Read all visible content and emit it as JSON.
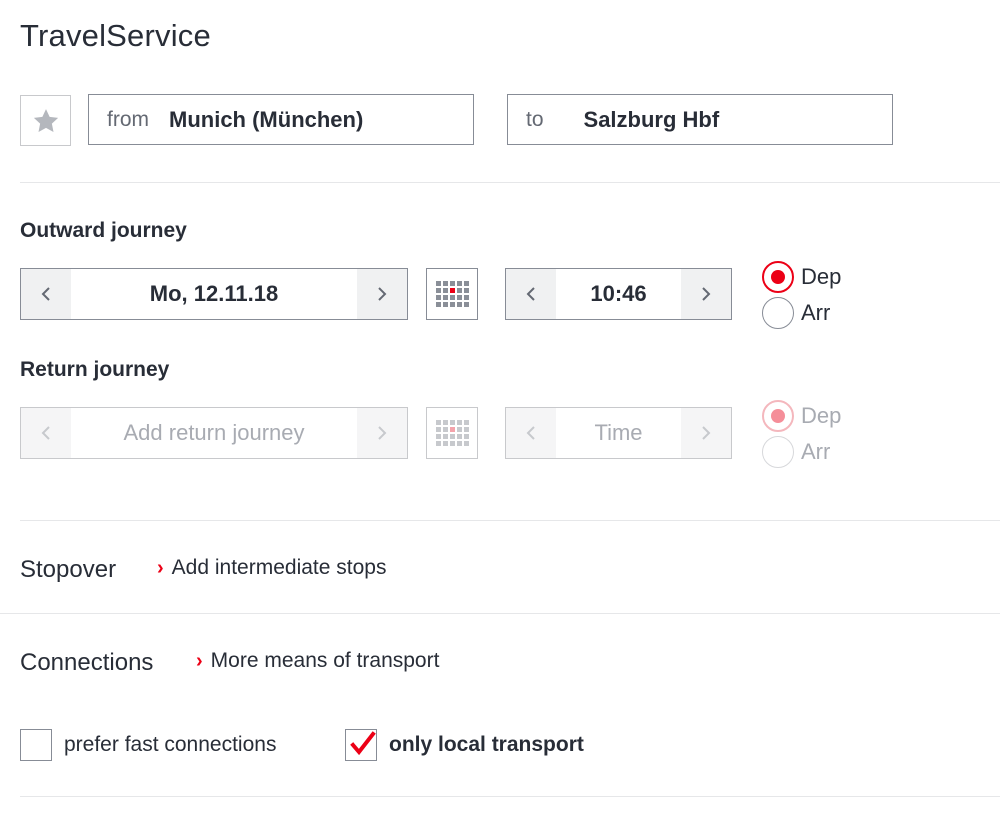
{
  "app": {
    "title": "TravelService"
  },
  "route": {
    "from_label": "from",
    "from_value": "Munich (München)",
    "to_label": "to",
    "to_value": "Salzburg Hbf"
  },
  "outward": {
    "heading": "Outward journey",
    "date": "Mo, 12.11.18",
    "time": "10:46",
    "dep_label": "Dep",
    "arr_label": "Arr",
    "selected": "Dep"
  },
  "return": {
    "heading": "Return journey",
    "date_placeholder": "Add return journey",
    "time_placeholder": "Time",
    "dep_label": "Dep",
    "arr_label": "Arr",
    "selected": "Dep"
  },
  "stopover": {
    "label": "Stopover",
    "link": "Add intermediate stops"
  },
  "connections": {
    "label": "Connections",
    "link": "More means of transport"
  },
  "options": {
    "fast": {
      "label": "prefer fast connections",
      "checked": false
    },
    "local": {
      "label": "only local transport",
      "checked": true
    }
  },
  "icons": {
    "favorite": "star-icon",
    "prev": "chevron-left-icon",
    "next": "chevron-right-icon",
    "calendar": "calendar-icon",
    "link": "chevron-right-icon",
    "check": "checkmark-icon"
  },
  "colors": {
    "accent": "#ec0016",
    "text": "#282d37",
    "border": "#878c96"
  }
}
